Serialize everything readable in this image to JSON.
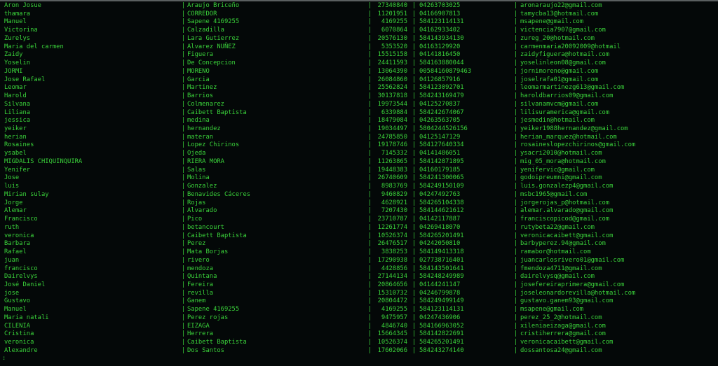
{
  "table": {
    "separator": "|",
    "rows": [
      [
        "Aron Josue",
        "Araujo Briceño",
        "27340840",
        "04263703025",
        "aronaraujo22@gmail.com"
      ],
      [
        "thamara",
        "CORREDOR",
        "11201951",
        "04166907813",
        "tamycba13@hotmail.com"
      ],
      [
        "Manuel",
        "Sapene 4169255",
        "4169255",
        "584123114131",
        "msapene@gmail.com"
      ],
      [
        "Victorina",
        "Calzadilla",
        "6070864",
        "04162933402",
        "victencia7907@gmail.com"
      ],
      [
        "Zurelys",
        "Lara Gutierrez",
        "20576130",
        "584143934130",
        "zureg_20@hotmail.com"
      ],
      [
        "Maria del carmen",
        "Alvarez NUÑEZ",
        "5353520",
        "04163129920",
        "carmenmaria20092009@hotmail"
      ],
      [
        "Zaidy",
        "Figuera",
        "15515158",
        "04141816450",
        "zaidyfiguera@hotmail.com"
      ],
      [
        "Yoselin",
        "De Concepcion",
        "24411593",
        "584163880044",
        "yoselinleon08@gmail.com"
      ],
      [
        "JORMI",
        "MORENO",
        "13064390",
        "00584160879463",
        "jornimoreno@gmail.com"
      ],
      [
        "Jose Rafael",
        "Garcia",
        "26084860",
        "04126857916",
        "joselrafa01@gmail.com"
      ],
      [
        "Leomar",
        "Martinez",
        "25562824",
        "584123092701",
        "leomarmartinezg613@gmail.com"
      ],
      [
        "Harold",
        "Barrios",
        "30137818",
        "584243169479",
        "haroldbarrios09@gmail.com"
      ],
      [
        "Silvana",
        "Colmenarez",
        "19973544",
        "04125270837",
        "silvanamvcm@gmail.com"
      ],
      [
        "Liliana",
        "Caibett Baptista",
        "6339884",
        "584242674067",
        "lilisuramerica@gmail.com"
      ],
      [
        "jessica",
        "medina",
        "18479084",
        "04263563705",
        "jesmedin@hotmail.com"
      ],
      [
        "yeiker",
        "hernandez",
        "19034497",
        "5804244526156",
        "yeiker1988hernandez@gmail.com"
      ],
      [
        "herian",
        "materan",
        "24785850",
        "04125147129",
        "herian_marquez@hotmail.com"
      ],
      [
        "Rosaines",
        "Lopez Chirinos",
        "19178746",
        "584127640334",
        "rosaineslopezchirinos@gmail.com"
      ],
      [
        "ysabel",
        "Ojeda",
        "7145332",
        "04141486051",
        "ysacri2010@hotmail.com"
      ],
      [
        "MIGDALIS CHIQUINQUIRA",
        "RIERA MORA",
        "11263865",
        "584142871895",
        "mig_05_mora@hotmail.com"
      ],
      [
        "Yenifer",
        "Salas",
        "19448383",
        "04160179185",
        "yenifervic@gmail.com"
      ],
      [
        "Jose",
        "Molina",
        "26740609",
        "584241300065",
        "godoipreumni@gmail.com"
      ],
      [
        "luis",
        "Gonzalez",
        "8983769",
        "584249150109",
        "luis.gonzalezp4@gmail.com"
      ],
      [
        "Mirian sulay",
        "Benavides Cáceres",
        "9460829",
        "04247492763",
        "msbc1965@gmail.com"
      ],
      [
        "Jorge",
        "Rojas",
        "4628921",
        "584265104338",
        "jorgerojas_p@hotmail.com"
      ],
      [
        "Alemar",
        "Alvarado",
        "7207430",
        "584144621612",
        "alemar.alvarado@gmail.com"
      ],
      [
        "Francisco",
        "Pico",
        "23710787",
        "04142117887",
        "franciscopicod@gmail.com"
      ],
      [
        "ruth",
        "betancourt",
        "12261774",
        "04269418070",
        "rutybeta22@gmail.com"
      ],
      [
        "veronica",
        "Caibett Baptista",
        "10526374",
        "584265201491",
        "veronicacaibett@gmail.com"
      ],
      [
        "Barbara",
        "Perez",
        "26476517",
        "04242050810",
        "barbyperez.94@gmail.com"
      ],
      [
        "Rafael",
        "Mata Borjas",
        "3838253",
        "584149413318",
        "ramabor@hotmail.com"
      ],
      [
        "juan",
        "rivero",
        "17290938",
        "027738716401",
        "juancarlosrivero01@gmail.com"
      ],
      [
        "francisco",
        "mendoza",
        "4428856",
        "584143501641",
        "fmendoza4711@gmail.com"
      ],
      [
        "Dairelvys",
        "Quintana",
        "27144134",
        "584248249989",
        "dairelvysq@gmail.com"
      ],
      [
        "José Daniel",
        "Fereira",
        "20864656",
        "04144241147",
        "josefereiraprimera@gmail.com"
      ],
      [
        "jose",
        "revilla",
        "15310732",
        "04246799878",
        "joseleonardorevilla@hotmail.com"
      ],
      [
        "Gustavo",
        "Ganem",
        "20804472",
        "584249499149",
        "gustavo.ganem93@gmail.com"
      ],
      [
        "Manuel",
        "Sapene 4169255",
        "4169255",
        "584123114131",
        "msapene@gmail.com"
      ],
      [
        "Maria natali",
        "Perez rojas",
        "9475957",
        "04247436906",
        "perez_25_2@hotmail.com"
      ],
      [
        "CILENIA",
        "EIZAGA",
        "4846740",
        "584166963052",
        "xileniaeizaga@gmail.com"
      ],
      [
        "Cristina",
        "Herrera",
        "15664345",
        "584142822691",
        "cristiherrera@gmail.com"
      ],
      [
        "veronica",
        "Caibett Baptista",
        "10526374",
        "584265201491",
        "veronicacaibett@gmail.com"
      ],
      [
        "Alexandre",
        "Dos Santos",
        "17602066",
        "584243274140",
        "dossantosa24@gmail.com"
      ]
    ]
  },
  "pager_prompt": ":",
  "colors": {
    "text": "#3ad23a",
    "background": "#040808"
  }
}
